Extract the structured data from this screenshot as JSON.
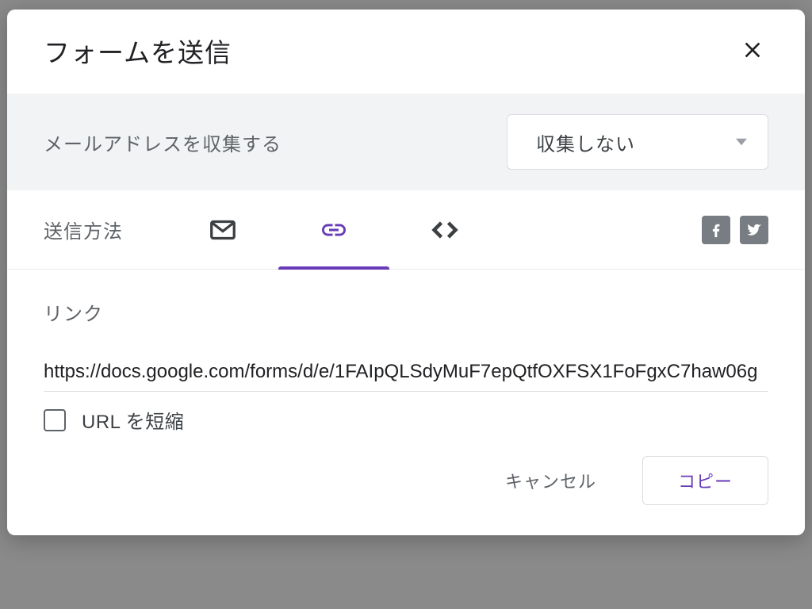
{
  "dialog": {
    "title": "フォームを送信"
  },
  "collect": {
    "label": "メールアドレスを収集する",
    "selected": "収集しない"
  },
  "tabs": {
    "label": "送信方法"
  },
  "link": {
    "sectionLabel": "リンク",
    "url": "https://docs.google.com/forms/d/e/1FAIpQLSdyMuF7epQtfOXFSX1FoFgxC7haw06g",
    "shortenLabel": "URL を短縮"
  },
  "footer": {
    "cancel": "キャンセル",
    "copy": "コピー"
  }
}
